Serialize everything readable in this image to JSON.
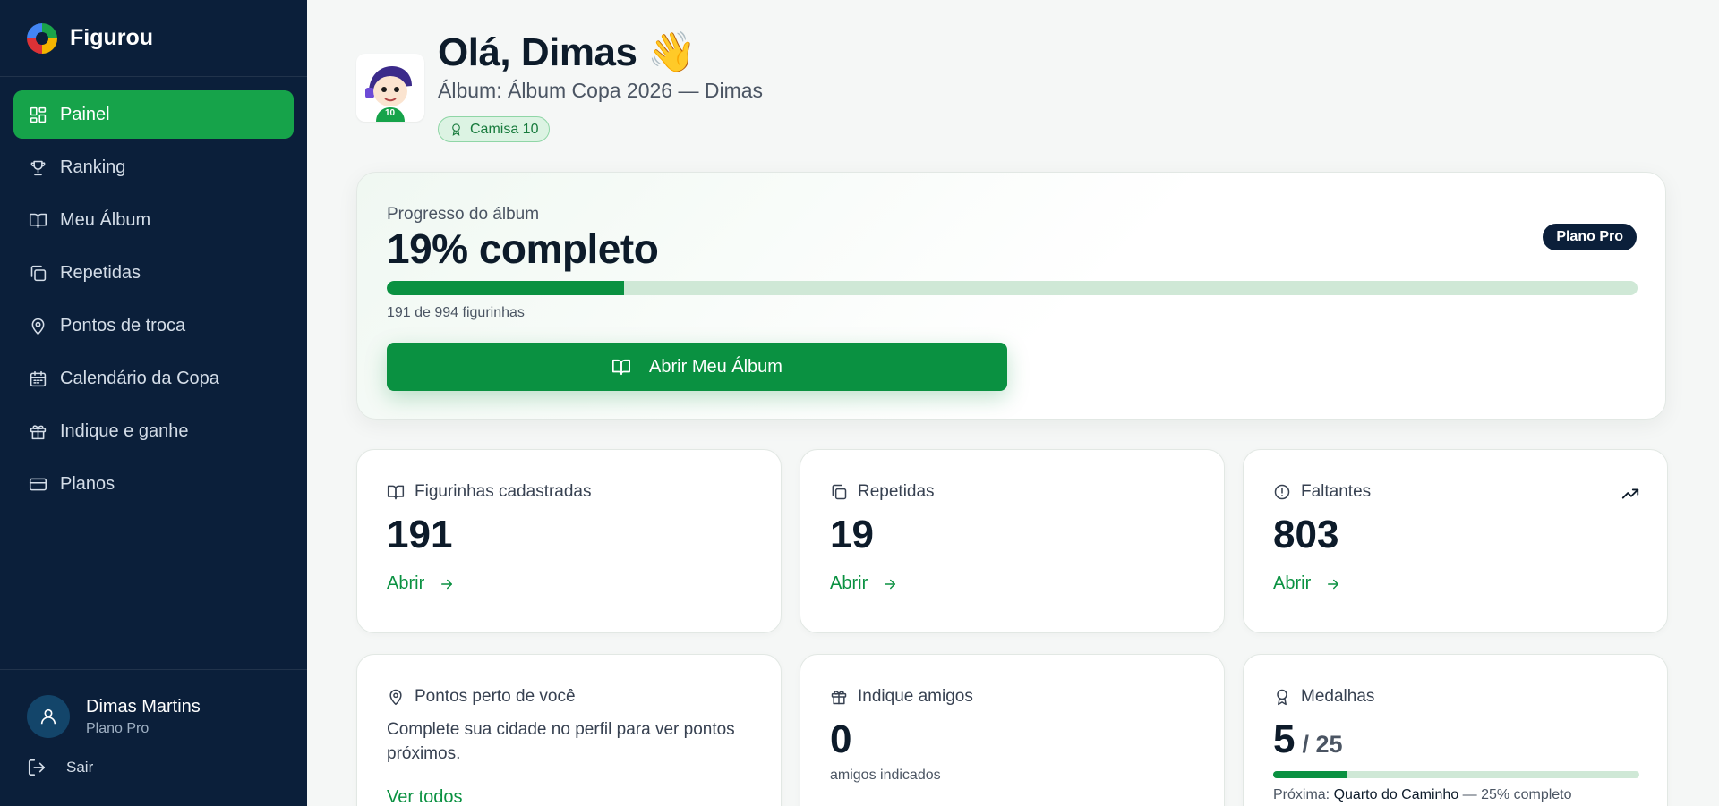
{
  "brand": {
    "name": "Figurou"
  },
  "sidebar": {
    "items": [
      {
        "label": "Painel",
        "icon": "dashboard-icon",
        "active": true
      },
      {
        "label": "Ranking",
        "icon": "trophy-icon"
      },
      {
        "label": "Meu Álbum",
        "icon": "book-icon"
      },
      {
        "label": "Repetidas",
        "icon": "copy-icon"
      },
      {
        "label": "Pontos de troca",
        "icon": "map-pin-icon"
      },
      {
        "label": "Calendário da Copa",
        "icon": "calendar-icon"
      },
      {
        "label": "Indique e ganhe",
        "icon": "gift-icon"
      },
      {
        "label": "Planos",
        "icon": "credit-card-icon"
      }
    ],
    "user": {
      "name": "Dimas Martins",
      "plan": "Plano Pro"
    },
    "logout_label": "Sair"
  },
  "header": {
    "greeting": "Olá, Dimas 👋",
    "album": "Álbum: Álbum Copa 2026 — Dimas",
    "badge": "Camisa 10",
    "mascot_number": "10"
  },
  "progress": {
    "label": "Progresso do álbum",
    "value_text": "19% completo",
    "percent": 19,
    "plan_badge": "Plano Pro",
    "count_text": "191 de 994 figurinhas",
    "button_label": "Abrir Meu Álbum"
  },
  "stats": [
    {
      "title": "Figurinhas cadastradas",
      "value": "191",
      "link": "Abrir",
      "icon": "book-icon"
    },
    {
      "title": "Repetidas",
      "value": "19",
      "link": "Abrir",
      "icon": "copy-icon"
    },
    {
      "title": "Faltantes",
      "value": "803",
      "link": "Abrir",
      "icon": "alert-circle-icon",
      "trend_icon": "trending-up-icon"
    }
  ],
  "points": {
    "title": "Pontos perto de você",
    "description": "Complete sua cidade no perfil para ver pontos próximos.",
    "link": "Ver todos"
  },
  "referral": {
    "title": "Indique amigos",
    "value": "0",
    "subtitle": "amigos indicados"
  },
  "medals": {
    "title": "Medalhas",
    "value": "5",
    "total": "/ 25",
    "fraction": 0.2,
    "next_prefix": "Próxima:",
    "next_name": "Quarto do Caminho",
    "next_suffix": "— 25% completo"
  },
  "colors": {
    "sidebar_bg": "#0b1f3a",
    "accent_green": "#0a9141",
    "active_nav": "#16a34a",
    "progress_track": "#cfe8d6"
  }
}
